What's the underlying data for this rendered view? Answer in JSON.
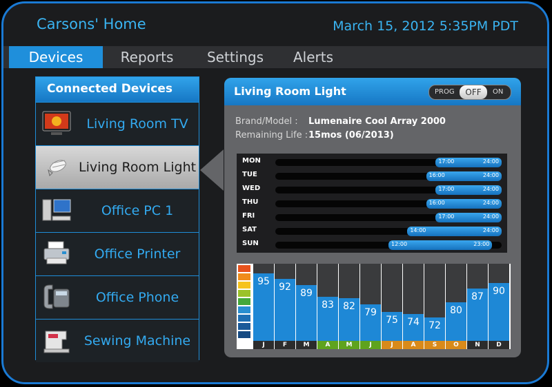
{
  "header": {
    "title": "Carsons' Home",
    "datetime": "March 15, 2012   5:35PM PDT"
  },
  "nav": {
    "tabs": [
      {
        "label": "Devices",
        "active": true
      },
      {
        "label": "Reports"
      },
      {
        "label": "Settings"
      },
      {
        "label": "Alerts"
      }
    ]
  },
  "devices": {
    "title": "Connected Devices",
    "items": [
      {
        "label": "Living Room TV",
        "icon": "tv-icon"
      },
      {
        "label": "Living Room Light",
        "icon": "light-bulb-icon",
        "selected": true
      },
      {
        "label": "Office PC 1",
        "icon": "computer-icon"
      },
      {
        "label": "Office Printer",
        "icon": "printer-icon"
      },
      {
        "label": "Office Phone",
        "icon": "phone-icon"
      },
      {
        "label": "Sewing Machine",
        "icon": "sewing-machine-icon"
      }
    ]
  },
  "detail": {
    "title": "Living Room Light",
    "toggle": {
      "prog": "PROG",
      "off": "OFF",
      "on": "ON",
      "state": "OFF"
    },
    "brand_label": "Brand/Model :",
    "brand_value": "Lumenaire Cool Array 2000",
    "life_label": "Remaining Life :",
    "life_value": "15mos (06/2013)",
    "schedule": [
      {
        "day": "MON",
        "start": "17:00",
        "end": "24:00"
      },
      {
        "day": "TUE",
        "start": "16:00",
        "end": "24:00"
      },
      {
        "day": "WED",
        "start": "17:00",
        "end": "24:00"
      },
      {
        "day": "THU",
        "start": "16:00",
        "end": "24:00"
      },
      {
        "day": "FRI",
        "start": "17:00",
        "end": "24:00"
      },
      {
        "day": "SAT",
        "start": "14:00",
        "end": "24:00"
      },
      {
        "day": "SUN",
        "start": "12:00",
        "end": "23:00"
      }
    ]
  },
  "chart_data": {
    "type": "bar",
    "categories": [
      "J",
      "F",
      "M",
      "A",
      "M",
      "J",
      "J",
      "A",
      "S",
      "O",
      "N",
      "D"
    ],
    "values": [
      95,
      92,
      89,
      83,
      82,
      79,
      75,
      74,
      72,
      80,
      87,
      90
    ],
    "ylim": [
      0,
      100
    ],
    "month_colors": [
      "#2c2c2c",
      "#2c2c2c",
      "#2c2c2c",
      "#5fa31d",
      "#5fa31d",
      "#5fa31d",
      "#d98a1a",
      "#d98a1a",
      "#d98a1a",
      "#d98a1a",
      "#2c2c2c",
      "#2c2c2c"
    ],
    "legend_colors": [
      "#e8531d",
      "#f08c1b",
      "#f6c31d",
      "#9bc22a",
      "#44a83a",
      "#2a8fd0",
      "#1f6fb3",
      "#1a5a99",
      "#164a82"
    ]
  }
}
